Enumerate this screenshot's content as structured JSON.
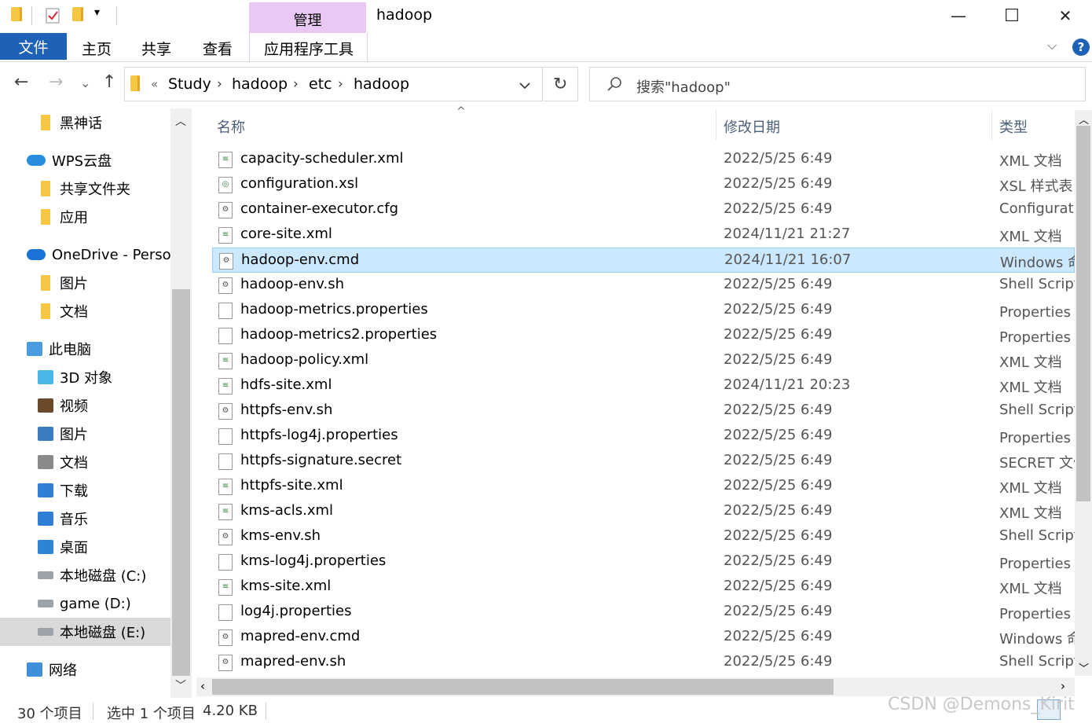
{
  "title_bar": {
    "context_tab": "管理",
    "window_title": "hadoop",
    "minimize": "—",
    "maximize": "☐",
    "close": "✕"
  },
  "ribbon": {
    "tabs": [
      "文件",
      "主页",
      "共享",
      "查看",
      "应用程序工具"
    ],
    "help": "?",
    "collapse": "⌵"
  },
  "address_bar": {
    "overflow": "«",
    "crumbs": [
      "Study",
      "hadoop",
      "etc",
      "hadoop"
    ],
    "separator": "›",
    "refresh": "↻",
    "back": "←",
    "forward": "→",
    "recent": "⌄",
    "up": "↑"
  },
  "search": {
    "placeholder": "搜索\"hadoop\""
  },
  "sidebar": {
    "items": [
      {
        "label": "黑神话",
        "icon": "folder-icon"
      },
      {
        "label": "WPS云盘",
        "icon": "cloud-icon"
      },
      {
        "label": "共享文件夹",
        "icon": "shared-folder-icon"
      },
      {
        "label": "应用",
        "icon": "apps-folder-icon"
      },
      {
        "label": "OneDrive - Persor",
        "icon": "onedrive-icon"
      },
      {
        "label": "图片",
        "icon": "folder-icon"
      },
      {
        "label": "文档",
        "icon": "folder-icon"
      },
      {
        "label": "此电脑",
        "icon": "computer-icon"
      },
      {
        "label": "3D 对象",
        "icon": "3d-objects-icon"
      },
      {
        "label": "视频",
        "icon": "video-icon"
      },
      {
        "label": "图片",
        "icon": "pictures-icon"
      },
      {
        "label": "文档",
        "icon": "documents-icon"
      },
      {
        "label": "下载",
        "icon": "download-icon"
      },
      {
        "label": "音乐",
        "icon": "music-icon"
      },
      {
        "label": "桌面",
        "icon": "desktop-icon"
      },
      {
        "label": "本地磁盘 (C:)",
        "icon": "drive-icon"
      },
      {
        "label": "game (D:)",
        "icon": "drive-icon"
      },
      {
        "label": "本地磁盘 (E:)",
        "icon": "drive-icon"
      },
      {
        "label": "网络",
        "icon": "network-icon"
      }
    ],
    "selected_index": 17
  },
  "file_list": {
    "columns": [
      "名称",
      "修改日期",
      "类型"
    ],
    "sort_indicator": "^",
    "selected_index": 4,
    "files": [
      {
        "name": "capacity-scheduler.xml",
        "date": "2022/5/25 6:49",
        "type": "XML 文档",
        "icon": "xml-file-icon"
      },
      {
        "name": "configuration.xsl",
        "date": "2022/5/25 6:49",
        "type": "XSL 样式表",
        "icon": "xsl-file-icon"
      },
      {
        "name": "container-executor.cfg",
        "date": "2022/5/25 6:49",
        "type": "Configurati",
        "icon": "cfg-file-icon"
      },
      {
        "name": "core-site.xml",
        "date": "2024/11/21 21:27",
        "type": "XML 文档",
        "icon": "xml-file-icon"
      },
      {
        "name": "hadoop-env.cmd",
        "date": "2024/11/21 16:07",
        "type": "Windows 命",
        "icon": "script-file-icon"
      },
      {
        "name": "hadoop-env.sh",
        "date": "2022/5/25 6:49",
        "type": "Shell Script",
        "icon": "script-file-icon"
      },
      {
        "name": "hadoop-metrics.properties",
        "date": "2022/5/25 6:49",
        "type": "Properties 文",
        "icon": "text-file-icon"
      },
      {
        "name": "hadoop-metrics2.properties",
        "date": "2022/5/25 6:49",
        "type": "Properties 文",
        "icon": "text-file-icon"
      },
      {
        "name": "hadoop-policy.xml",
        "date": "2022/5/25 6:49",
        "type": "XML 文档",
        "icon": "xml-file-icon"
      },
      {
        "name": "hdfs-site.xml",
        "date": "2024/11/21 20:23",
        "type": "XML 文档",
        "icon": "xml-file-icon"
      },
      {
        "name": "httpfs-env.sh",
        "date": "2022/5/25 6:49",
        "type": "Shell Script",
        "icon": "script-file-icon"
      },
      {
        "name": "httpfs-log4j.properties",
        "date": "2022/5/25 6:49",
        "type": "Properties 文",
        "icon": "text-file-icon"
      },
      {
        "name": "httpfs-signature.secret",
        "date": "2022/5/25 6:49",
        "type": "SECRET 文件",
        "icon": "blank-file-icon"
      },
      {
        "name": "httpfs-site.xml",
        "date": "2022/5/25 6:49",
        "type": "XML 文档",
        "icon": "xml-file-icon"
      },
      {
        "name": "kms-acls.xml",
        "date": "2022/5/25 6:49",
        "type": "XML 文档",
        "icon": "xml-file-icon"
      },
      {
        "name": "kms-env.sh",
        "date": "2022/5/25 6:49",
        "type": "Shell Script",
        "icon": "script-file-icon"
      },
      {
        "name": "kms-log4j.properties",
        "date": "2022/5/25 6:49",
        "type": "Properties 文",
        "icon": "text-file-icon"
      },
      {
        "name": "kms-site.xml",
        "date": "2022/5/25 6:49",
        "type": "XML 文档",
        "icon": "xml-file-icon"
      },
      {
        "name": "log4j.properties",
        "date": "2022/5/25 6:49",
        "type": "Properties 文",
        "icon": "text-file-icon"
      },
      {
        "name": "mapred-env.cmd",
        "date": "2022/5/25 6:49",
        "type": "Windows 命",
        "icon": "script-file-icon"
      },
      {
        "name": "mapred-env.sh",
        "date": "2022/5/25 6:49",
        "type": "Shell Script",
        "icon": "script-file-icon"
      }
    ]
  },
  "status_bar": {
    "item_count": "30 个项目",
    "selection": "选中 1 个项目",
    "size": "4.20 KB"
  },
  "watermark": "CSDN @Demons_Kirit",
  "colors": {
    "file_tab": "#1e62b8",
    "manage_tab": "#e9c8f3",
    "selection": "#cce8ff",
    "folder": "#f6c744"
  }
}
